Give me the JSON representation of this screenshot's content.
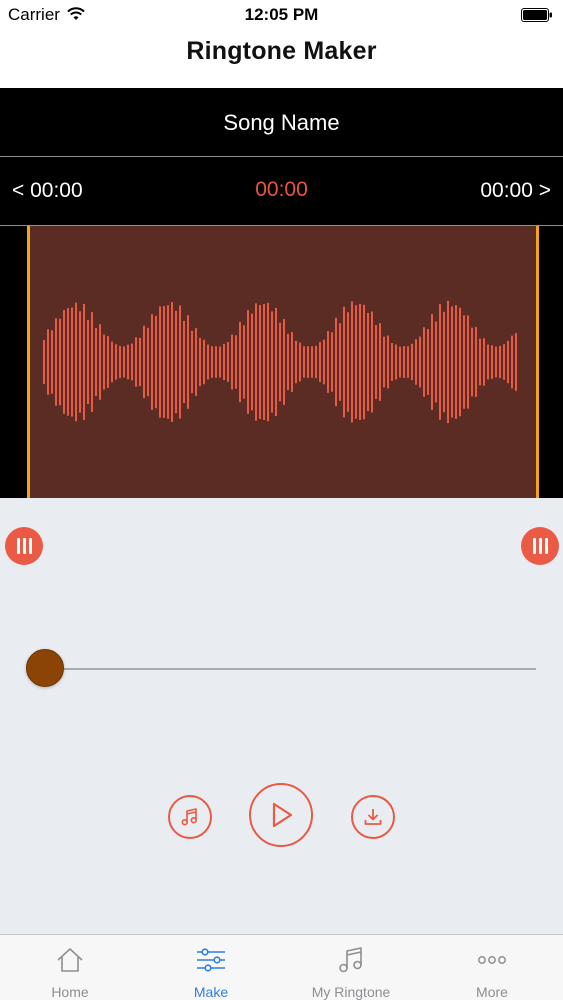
{
  "status_bar": {
    "carrier": "Carrier",
    "time": "12:05 PM"
  },
  "nav": {
    "title": "Ringtone Maker"
  },
  "editor": {
    "song_name": "Song Name",
    "start_time": "< 00:00",
    "current_time": "00:00",
    "end_time": "00:00 >"
  },
  "playback": {
    "progress": 0
  },
  "tabs": [
    {
      "label": "Home",
      "icon": "home-icon",
      "active": false
    },
    {
      "label": "Make",
      "icon": "sliders-icon",
      "active": true
    },
    {
      "label": "My Ringtone",
      "icon": "music-note-icon",
      "active": false
    },
    {
      "label": "More",
      "icon": "more-icon",
      "active": false
    }
  ],
  "colors": {
    "accent": "#e85a45",
    "trim_line": "#f2a516",
    "selection": "#5b2c24",
    "tab_active": "#2f7fe0",
    "slider_thumb": "#8c4406"
  }
}
